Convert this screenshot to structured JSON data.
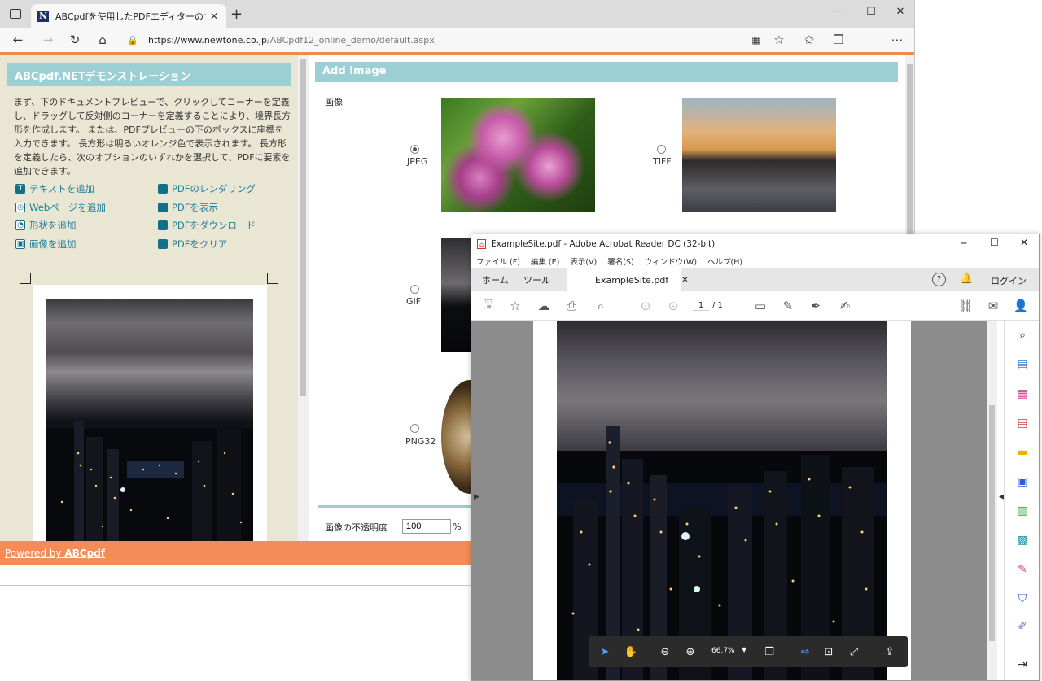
{
  "browser": {
    "tab_title": "ABCpdfを使用したPDFエディターのサ",
    "new_tab": "+",
    "url_host": "https://www.newtone.co.jp",
    "url_path": "/ABCpdf12_online_demo/default.aspx"
  },
  "left": {
    "heading": "ABCpdf.NETデモンストレーション",
    "description": "まず、下のドキュメントプレビューで、クリックしてコーナーを定義し、ドラッグして反対側のコーナーを定義することにより、境界長方形を作成します。 または、PDFプレビューの下のボックスに座標を入力できます。 長方形は明るいオレンジ色で表示されます。 長方形を定義したら、次のオプションのいずれかを選択して、PDFに要素を追加できます。",
    "links_col1": [
      {
        "label": "テキストを追加",
        "icon": "text-icon"
      },
      {
        "label": "Webページを追加",
        "icon": "globe-icon"
      },
      {
        "label": "形状を追加",
        "icon": "shape-icon"
      },
      {
        "label": "画像を追加",
        "icon": "image-icon"
      }
    ],
    "links_col2": [
      {
        "label": "PDFのレンダリング",
        "icon": "render-icon"
      },
      {
        "label": "PDFを表示",
        "icon": "view-icon"
      },
      {
        "label": "PDFをダウンロード",
        "icon": "download-icon"
      },
      {
        "label": "PDFをクリア",
        "icon": "clear-icon"
      }
    ]
  },
  "right": {
    "heading": "Add Image",
    "image_label": "画像",
    "options": {
      "jpeg": "JPEG",
      "tiff": "TIFF",
      "gif": "GIF",
      "png32": "PNG32"
    },
    "selected": "JPEG",
    "opacity_label": "画像の不透明度",
    "opacity_value": "100",
    "opacity_unit": "%"
  },
  "footer": {
    "powered_prefix": "Powered by ",
    "powered_brand": "ABCpdf"
  },
  "acrobat": {
    "title": "ExampleSite.pdf - Adobe Acrobat Reader DC (32-bit)",
    "menu": [
      "ファイル (F)",
      "編集 (E)",
      "表示(V)",
      "署名(S)",
      "ウィンドウ(W)",
      "ヘルプ(H)"
    ],
    "tab_home": "ホーム",
    "tab_tools": "ツール",
    "tab_doc": "ExampleSite.pdf",
    "login": "ログイン",
    "page_current": "1",
    "page_total": "/ 1",
    "zoom": "66.7%"
  },
  "colors": {
    "accent_teal": "#9ccfd3",
    "footer_orange": "#f58b57",
    "left_bg": "#eae6d4",
    "link_color": "#1e7d9c"
  }
}
